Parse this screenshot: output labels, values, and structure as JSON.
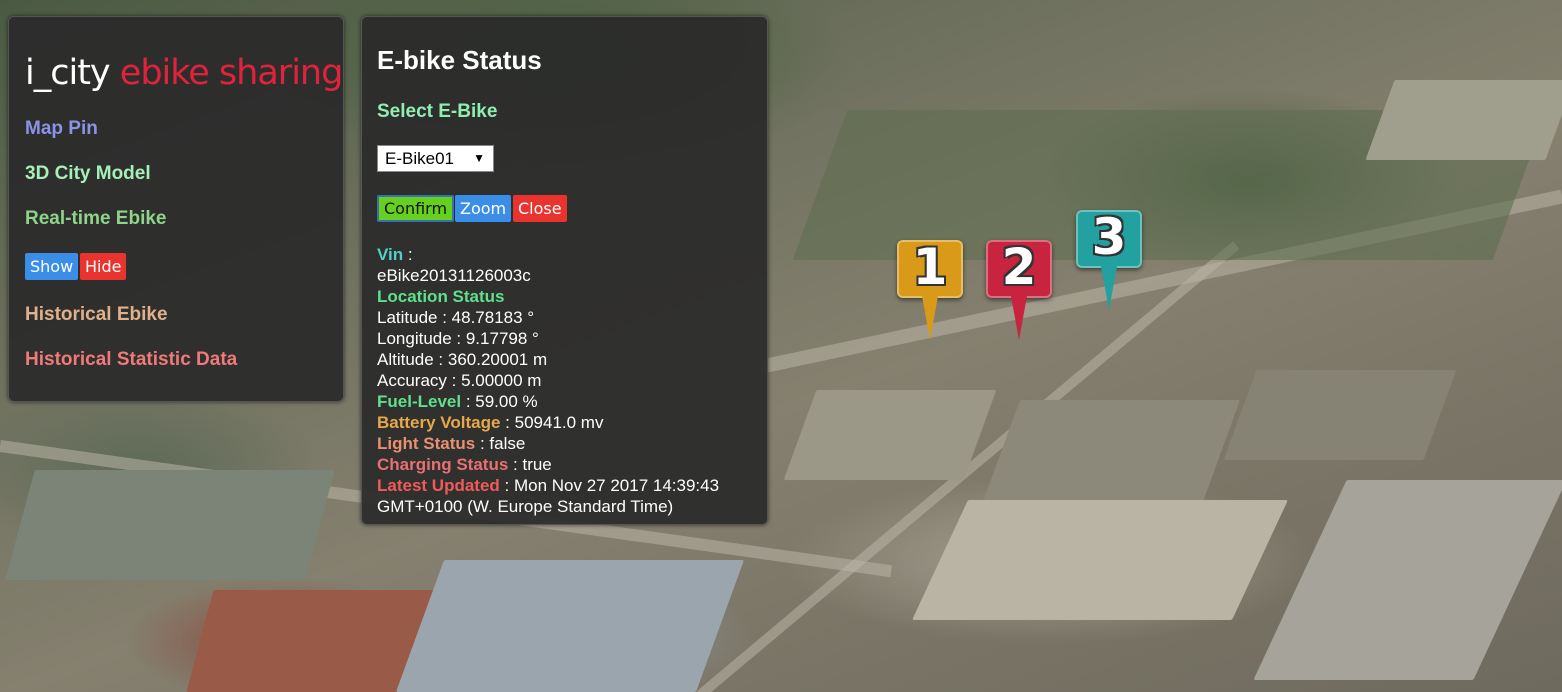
{
  "app": {
    "title_part1": "i_city",
    "title_part2": "ebike sharing"
  },
  "menu": {
    "map_pin": "Map Pin",
    "city_model": "3D City Model",
    "realtime": "Real-time Ebike",
    "show_button": "Show",
    "hide_button": "Hide",
    "historical": "Historical Ebike",
    "statistic": "Historical Statistic Data"
  },
  "status": {
    "title": "E-bike Status",
    "select_label": "Select E-Bike",
    "selected_bike": "E-Bike01",
    "confirm_button": "Confirm",
    "zoom_button": "Zoom",
    "close_button": "Close",
    "vin_label": "Vin",
    "vin_sep": " :",
    "vin_value": "eBike20131126003c",
    "location_label": "Location Status",
    "latitude": "Latitude : 48.78183 °",
    "longitude": "Longitude : 9.17798 °",
    "altitude": "Altitude : 360.20001 m",
    "accuracy": "Accuracy : 5.00000 m",
    "fuel_label": "Fuel-Level",
    "fuel_value": " : 59.00 %",
    "battery_label": "Battery Voltage",
    "battery_value": " : 50941.0 mv",
    "light_label": "Light Status",
    "light_value": " : false",
    "charging_label": "Charging Status",
    "charging_value": " : true",
    "updated_label": "Latest Updated",
    "updated_value": " : Mon Nov 27 2017 14:39:43",
    "updated_value_line2": "GMT+0100 (W. Europe Standard Time)"
  },
  "map_pins": [
    {
      "label": "1",
      "color": "#d99a1a"
    },
    {
      "label": "2",
      "color": "#c8233f"
    },
    {
      "label": "3",
      "color": "#23a0a0"
    }
  ],
  "colors": {
    "title_accent": "#e0223d",
    "map_pin_nav": "#8a93e6",
    "city_model_nav": "#a6f0b8",
    "realtime_nav": "#8ed48a",
    "historical_nav": "#e0b08a",
    "statistic_nav": "#f07a7a",
    "show_button": "#3b8ee8",
    "hide_button": "#e8332f",
    "confirm_button": "#66d01e",
    "zoom_button": "#3b8ee8",
    "close_button": "#e8332f"
  }
}
